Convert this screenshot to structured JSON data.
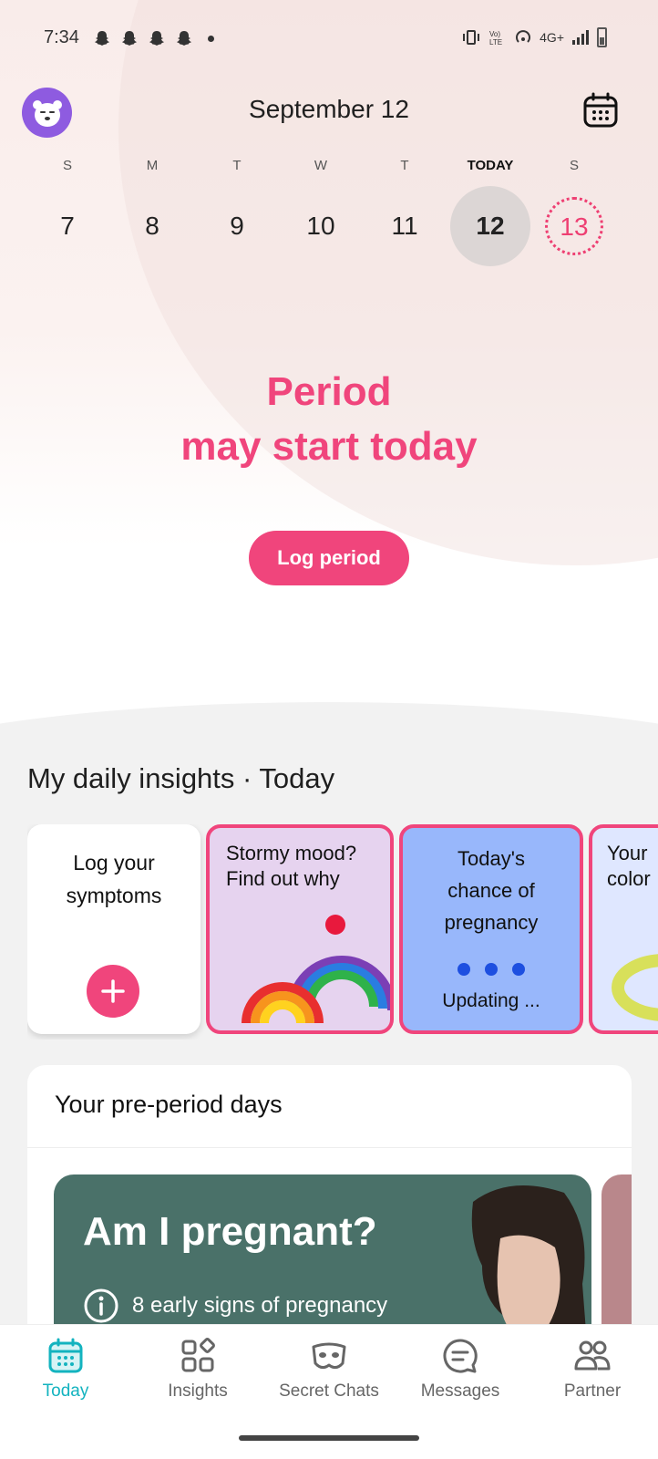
{
  "status_bar": {
    "time": "7:34",
    "network": "4G+"
  },
  "header": {
    "date_title": "September 12"
  },
  "week": [
    {
      "letter": "S",
      "number": "7",
      "state": "normal"
    },
    {
      "letter": "M",
      "number": "8",
      "state": "normal"
    },
    {
      "letter": "T",
      "number": "9",
      "state": "normal"
    },
    {
      "letter": "W",
      "number": "10",
      "state": "normal"
    },
    {
      "letter": "T",
      "number": "11",
      "state": "normal"
    },
    {
      "letter": "TODAY",
      "number": "12",
      "state": "selected"
    },
    {
      "letter": "S",
      "number": "13",
      "state": "predicted"
    }
  ],
  "hero": {
    "line1": "Period",
    "line2": "may start today",
    "button": "Log period"
  },
  "insights": {
    "title": "My daily insights · Today",
    "cards": {
      "log_line1": "Log your",
      "log_line2": "symptoms",
      "mood_line1": "Stormy mood?",
      "mood_line2": "Find out why",
      "chance_line1": "Today's",
      "chance_line2": "chance of",
      "chance_line3": "pregnancy",
      "chance_status": "Updating ...",
      "color_line1": "Your",
      "color_line2": "color"
    }
  },
  "pre_period": {
    "title": "Your pre-period days",
    "story_title": "Am I pregnant?",
    "story_sub": "8 early signs of pregnancy"
  },
  "nav": [
    {
      "label": "Today",
      "icon": "calendar-icon",
      "active": true
    },
    {
      "label": "Insights",
      "icon": "grid-icon",
      "active": false
    },
    {
      "label": "Secret Chats",
      "icon": "mask-icon",
      "active": false
    },
    {
      "label": "Messages",
      "icon": "chat-icon",
      "active": false
    },
    {
      "label": "Partner",
      "icon": "people-icon",
      "active": false
    }
  ],
  "colors": {
    "accent_pink": "#f0457c",
    "accent_teal": "#13b3bf",
    "avatar_purple": "#8e5be0",
    "story_green": "#4a7169"
  }
}
